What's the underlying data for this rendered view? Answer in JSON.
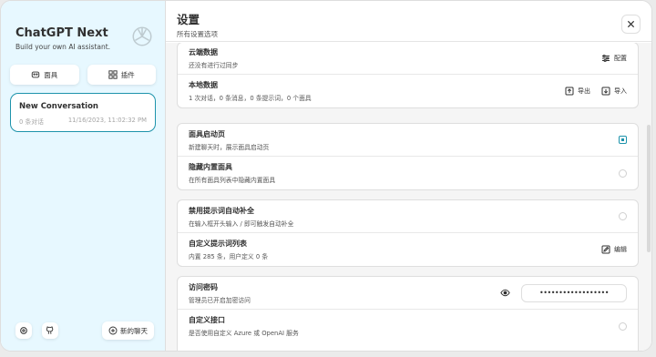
{
  "sidebar": {
    "title": "ChatGPT Next",
    "subtitle": "Build your own AI assistant.",
    "mask_label": "面具",
    "plugin_label": "插件",
    "conversation": {
      "title": "New Conversation",
      "count": "0 条对话",
      "date": "11/16/2023, 11:02:32 PM"
    },
    "new_chat_label": "新的聊天"
  },
  "header": {
    "title": "设置",
    "subtitle": "所有设置选项"
  },
  "sync": {
    "cloud_title": "云端数据",
    "cloud_sub": "还没有进行过同步",
    "config_label": "配置",
    "local_title": "本地数据",
    "local_sub": "1 次对话，0 条消息，0 条提示词，0 个面具",
    "export_label": "导出",
    "import_label": "导入"
  },
  "mask": {
    "splash_title": "面具启动页",
    "splash_sub": "新建聊天时，展示面具启动页",
    "hide_title": "隐藏内置面具",
    "hide_sub": "在所有面具列表中隐藏内置面具"
  },
  "prompt": {
    "disable_title": "禁用提示词自动补全",
    "disable_sub": "在输入框开头输入 / 即可触发自动补全",
    "custom_title": "自定义提示词列表",
    "custom_sub": "内置 285 条，用户定义 0 条",
    "edit_label": "编辑"
  },
  "access": {
    "password_title": "访问密码",
    "password_sub": "管理员已开启加密访问",
    "password_value": "••••••••••••••••••",
    "endpoint_title": "自定义接口",
    "endpoint_sub": "是否使用自定义 Azure 或 OpenAI 服务"
  },
  "colors": {
    "accent": "#1d93ab",
    "sidebar_bg": "#e7f8ff"
  }
}
